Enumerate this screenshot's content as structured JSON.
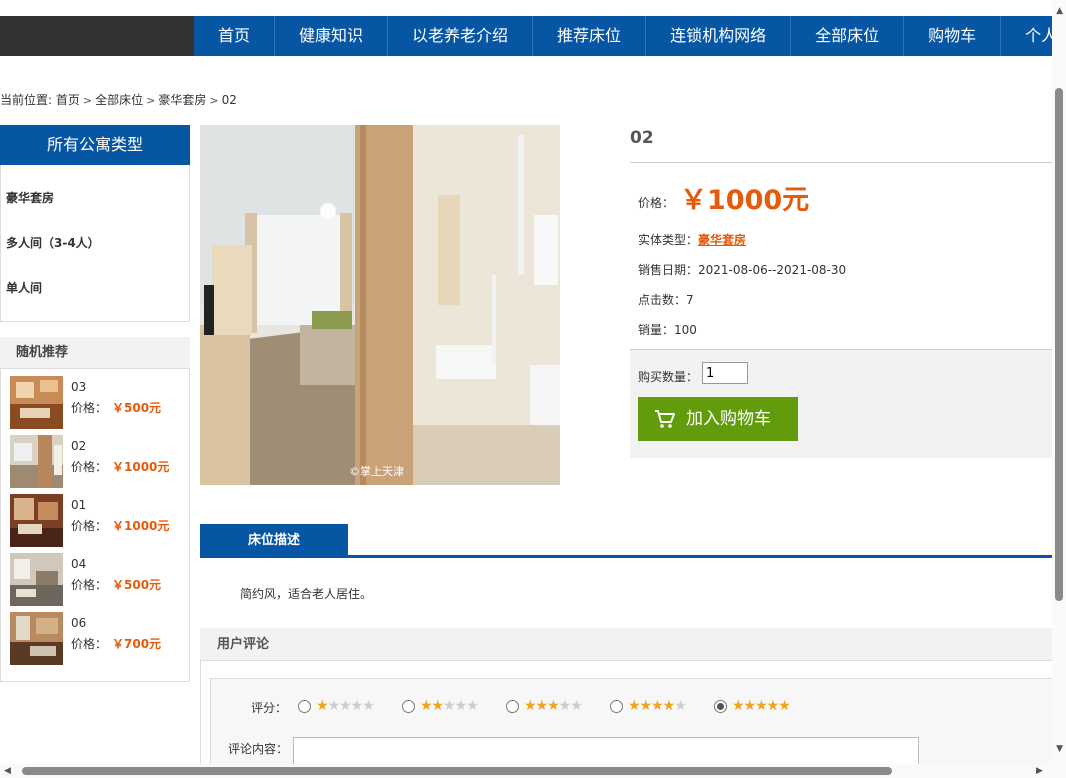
{
  "nav": {
    "items": [
      "首页",
      "健康知识",
      "以老养老介绍",
      "推荐床位",
      "连锁机构网络",
      "全部床位",
      "购物车",
      "个人"
    ]
  },
  "breadcrumb": {
    "prefix": "当前位置: ",
    "items": [
      "首页",
      "全部床位",
      "豪华套房",
      "02"
    ]
  },
  "sidebar": {
    "category_title": "所有公寓类型",
    "categories": [
      "豪华套房",
      "多人间（3-4人）",
      "单人间"
    ],
    "recommend_title": "随机推荐",
    "recommend": [
      {
        "name": "03",
        "price_label": "价格：",
        "price": "￥500元"
      },
      {
        "name": "02",
        "price_label": "价格：",
        "price": "￥1000元"
      },
      {
        "name": "01",
        "price_label": "价格：",
        "price": "￥1000元"
      },
      {
        "name": "04",
        "price_label": "价格：",
        "price": "￥500元"
      },
      {
        "name": "06",
        "price_label": "价格：",
        "price": "￥700元"
      }
    ]
  },
  "product": {
    "image_watermark": "©掌上天津",
    "title": "02",
    "price_label": "价格：",
    "price": "￥1000元",
    "type_label": "实体类型：",
    "type_value": "豪华套房",
    "date_label": "销售日期：",
    "date_value": "2021-08-06--2021-08-30",
    "clicks_label": "点击数：",
    "clicks_value": "7",
    "sales_label": "销量：",
    "sales_value": "100",
    "qty_label": "购买数量：",
    "qty_value": "1",
    "cart_button": "加入购物车"
  },
  "tabs": {
    "active": "床位描述"
  },
  "description": "简约风，适合老人居住。",
  "comments": {
    "title": "用户评论",
    "rating_label": "评分：",
    "rating_options": [
      1,
      2,
      3,
      4,
      5
    ],
    "rating_selected": 5,
    "content_label": "评论内容："
  },
  "colors": {
    "nav_blue": "#0656a4",
    "price_orange": "#e55b0b",
    "cart_green": "#629b0b",
    "star_gold": "#f1a41a"
  }
}
